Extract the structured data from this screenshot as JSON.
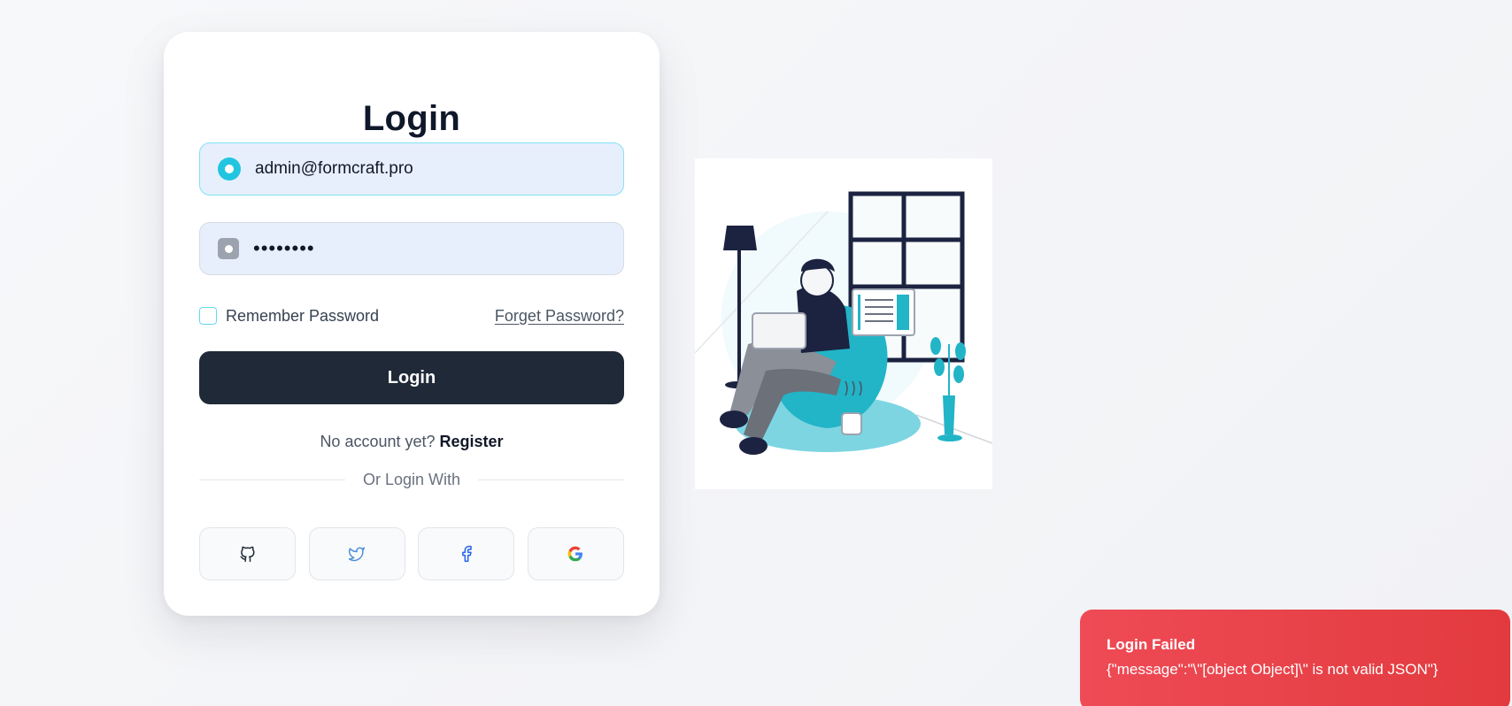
{
  "login_form": {
    "title": "Login",
    "email_value": "admin@formcraft.pro",
    "password_value": "••••••••",
    "remember_label": "Remember Password",
    "forgot_label": "Forget Password?",
    "submit_label": "Login",
    "no_account_text": "No account yet?",
    "register_label": "Register",
    "divider_text": "Or Login With",
    "social_buttons": [
      {
        "icon": "github-icon"
      },
      {
        "icon": "twitter-icon"
      },
      {
        "icon": "facebook-icon"
      },
      {
        "icon": "google-icon"
      }
    ]
  },
  "toast": {
    "title": "Login Failed",
    "message": "{\"message\":\"\\\"[object Object]\\\" is not valid JSON\"}"
  },
  "colors": {
    "accent": "#22c5e0",
    "button_dark": "#1f2937",
    "error": "#e23a3e"
  }
}
